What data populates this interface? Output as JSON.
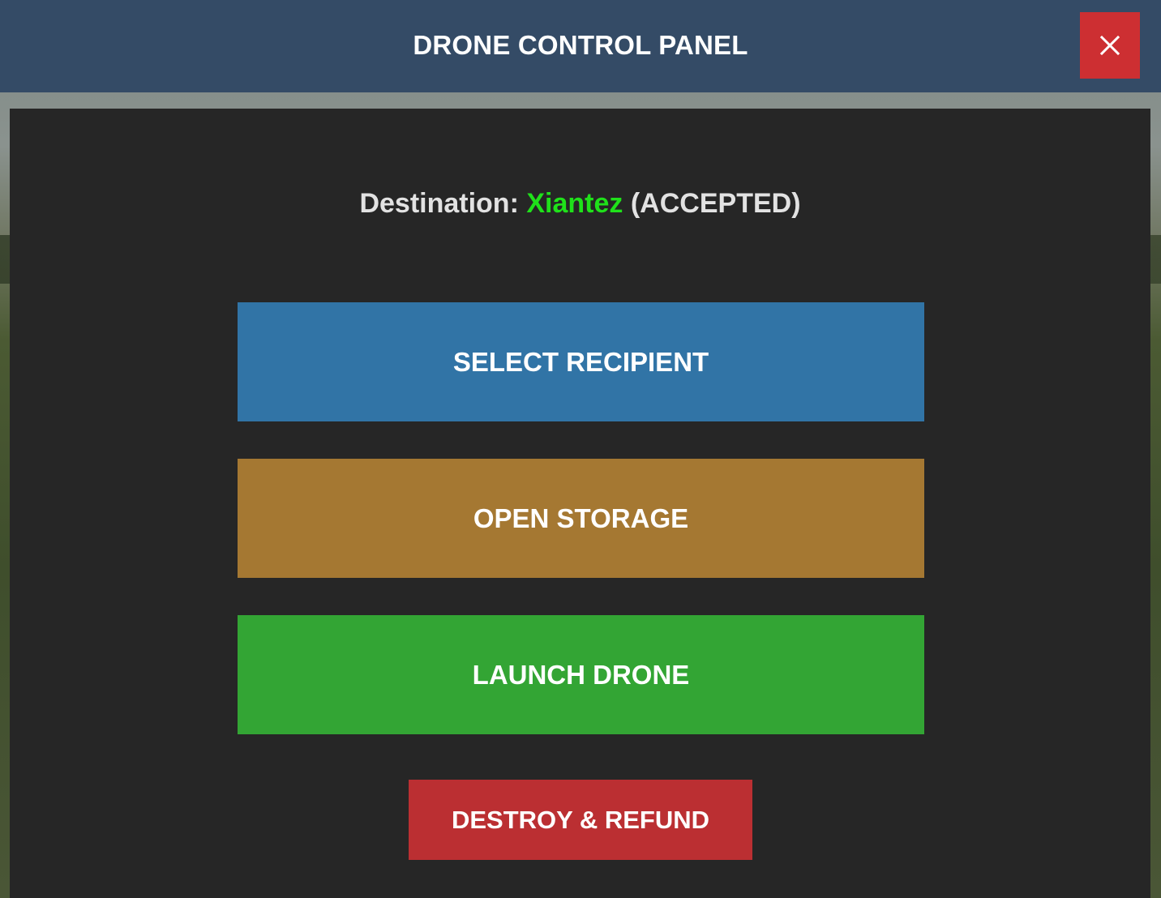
{
  "header": {
    "title": "DRONE CONTROL PANEL",
    "close_icon": "close-icon"
  },
  "destination": {
    "label": "Destination:",
    "name": "Xiantez",
    "status": "(ACCEPTED)"
  },
  "buttons": {
    "select_recipient": "SELECT RECIPIENT",
    "open_storage": "OPEN STORAGE",
    "launch_drone": "LAUNCH DRONE",
    "destroy_refund": "DESTROY & REFUND"
  },
  "colors": {
    "header_bg": "#344b66",
    "close_bg": "#cd2f32",
    "panel_bg": "#262626",
    "destination_name": "#1fe11a",
    "select_recipient_bg": "#3174a6",
    "open_storage_bg": "#a57832",
    "launch_drone_bg": "#33a534",
    "destroy_refund_bg": "#bb2f32"
  }
}
